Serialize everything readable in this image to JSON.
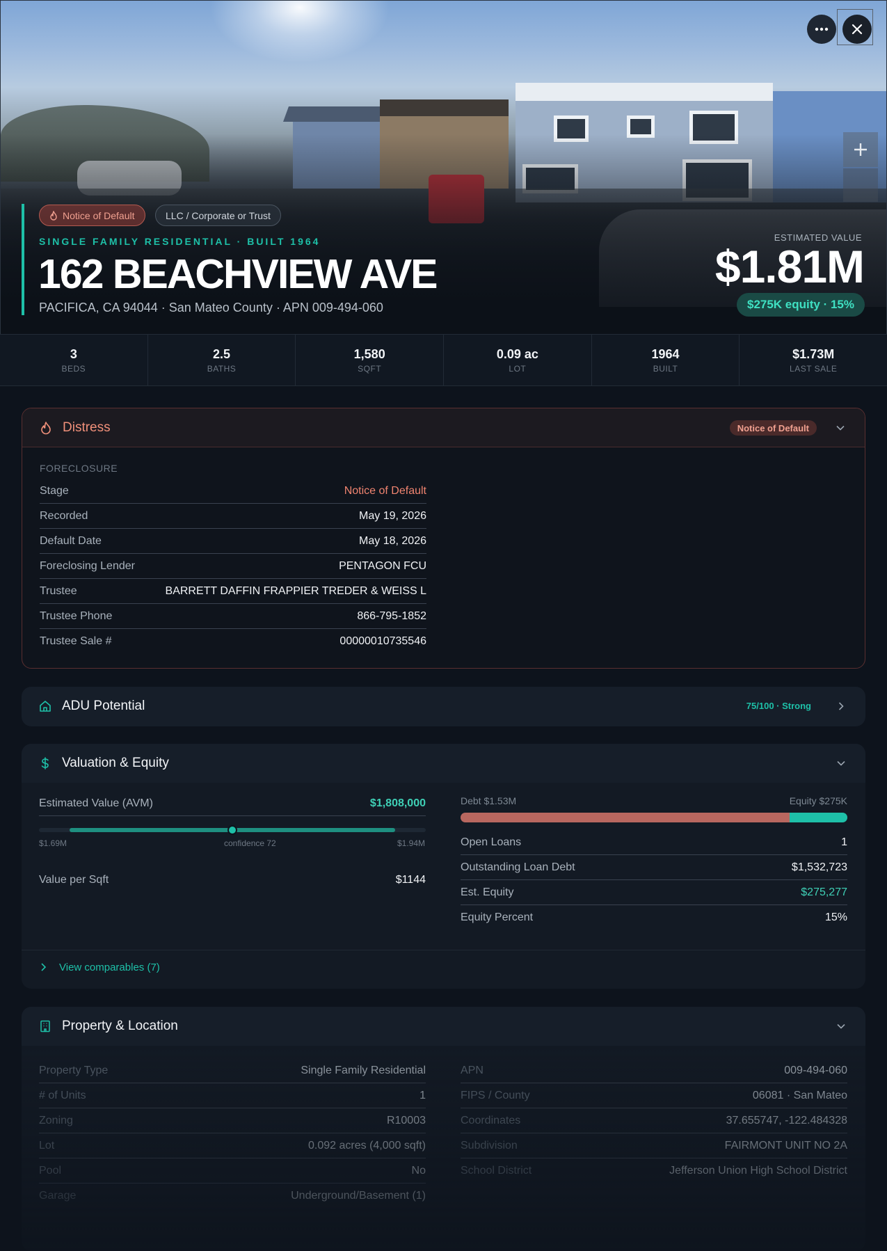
{
  "hero": {
    "chip_distress": "Notice of Default",
    "chip_owner": "LLC / Corporate or Trust",
    "subtitle": "SINGLE FAMILY RESIDENTIAL · BUILT 1964",
    "address": "162 BEACHVIEW AVE",
    "address_sub": "PACIFICA, CA 94044 · San Mateo County · APN 009-494-060",
    "est_label": "ESTIMATED VALUE",
    "est_value": "$1.81M",
    "equity_pill": "$275K equity · 15%"
  },
  "stats": [
    {
      "value": "3",
      "label": "BEDS"
    },
    {
      "value": "2.5",
      "label": "BATHS"
    },
    {
      "value": "1,580",
      "label": "SQFT"
    },
    {
      "value": "0.09 ac",
      "label": "LOT"
    },
    {
      "value": "1964",
      "label": "BUILT"
    },
    {
      "value": "$1.73M",
      "label": "LAST SALE"
    }
  ],
  "distress": {
    "title": "Distress",
    "badge": "Notice of Default",
    "section_label": "FORECLOSURE",
    "rows": [
      {
        "k": "Stage",
        "v": "Notice of Default"
      },
      {
        "k": "Recorded",
        "v": "May 19, 2026"
      },
      {
        "k": "Default Date",
        "v": "May 18, 2026"
      },
      {
        "k": "Foreclosing Lender",
        "v": "PENTAGON FCU"
      },
      {
        "k": "Trustee",
        "v": "BARRETT DAFFIN FRAPPIER TREDER & WEISS L"
      },
      {
        "k": "Trustee Phone",
        "v": "866-795-1852"
      },
      {
        "k": "Trustee Sale #",
        "v": "00000010735546"
      }
    ]
  },
  "adu": {
    "title": "ADU Potential",
    "score": "75/100 · Strong"
  },
  "valuation": {
    "title": "Valuation & Equity",
    "avm_label": "Estimated Value (AVM)",
    "avm_value": "$1,808,000",
    "range_low": "$1.69M",
    "range_mid": "confidence 72",
    "range_high": "$1.94M",
    "range_fill_start": 0.08,
    "range_fill_end": 0.92,
    "range_dot": 0.5,
    "ppsf_label": "Value per Sqft",
    "ppsf_value": "$1144",
    "debt_label": "Debt $1.53M",
    "equity_label": "Equity $275K",
    "debt_fraction": 0.85,
    "rows": [
      {
        "k": "Open Loans",
        "v": "1"
      },
      {
        "k": "Outstanding Loan Debt",
        "v": "$1,532,723"
      },
      {
        "k": "Est. Equity",
        "v": "$275,277"
      },
      {
        "k": "Equity Percent",
        "v": "15%"
      }
    ],
    "view_comps": "View comparables (7)"
  },
  "property": {
    "title": "Property & Location",
    "left": [
      {
        "k": "Property Type",
        "v": "Single Family Residential"
      },
      {
        "k": "# of Units",
        "v": "1"
      },
      {
        "k": "Zoning",
        "v": "R10003"
      },
      {
        "k": "Lot",
        "v": "0.092 acres (4,000 sqft)"
      },
      {
        "k": "Pool",
        "v": "No"
      },
      {
        "k": "Garage",
        "v": "Underground/Basement (1)"
      }
    ],
    "right": [
      {
        "k": "APN",
        "v": "009-494-060"
      },
      {
        "k": "FIPS / County",
        "v": "06081 · San Mateo"
      },
      {
        "k": "Coordinates",
        "v": "37.655747, -122.484328"
      },
      {
        "k": "Subdivision",
        "v": "FAIRMONT UNIT NO 2A"
      },
      {
        "k": "School District",
        "v": "Jefferson Union High School District"
      }
    ]
  },
  "colors": {
    "accent": "#1ec0a8",
    "distress": "#f0907a",
    "debt": "#b8675f"
  }
}
